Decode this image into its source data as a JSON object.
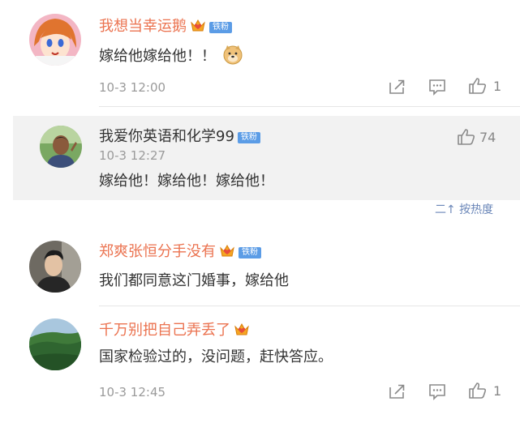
{
  "comments": [
    {
      "user": "我想当幸运鹅",
      "badge": "铁粉",
      "text": "嫁给他嫁给他！！",
      "emoji": "doge-emoji",
      "time": "10-3 12:00",
      "likes": "1"
    },
    {
      "user": "郑爽张恒分手没有",
      "badge": "铁粉",
      "text": "我们都同意这门婚事，嫁给他"
    },
    {
      "user": "千万别把自己弄丢了",
      "text": "国家检验过的，没问题，赶快答应。",
      "time": "10-3 12:45",
      "likes": "1"
    }
  ],
  "reply": {
    "user": "我爱你英语和化学99",
    "badge": "铁粉",
    "time": "10-3 12:27",
    "text": "嫁给他！嫁给他！嫁给他！",
    "likes": "74"
  },
  "sort_link": "二↑ 按热度",
  "icons": {
    "share": "share-icon",
    "comment": "comment-icon",
    "like": "thumbs-up-icon",
    "vip": "vip-crown-icon"
  },
  "colors": {
    "username": "#eb7350",
    "badge": "#5b9ce6",
    "reply_bg": "#f2f2f2",
    "timestamp": "#9a9a9a"
  }
}
